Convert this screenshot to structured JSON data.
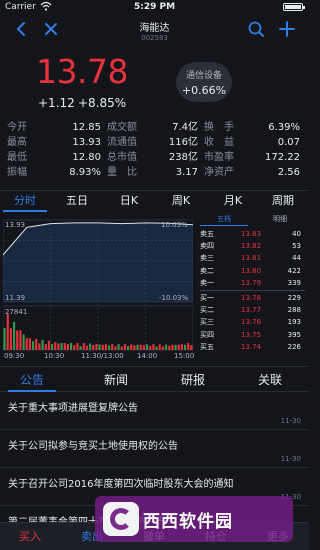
{
  "status_bar": {
    "carrier": "Carrier",
    "time": "5:29 PM"
  },
  "nav": {
    "title": "海能达",
    "code": "002583"
  },
  "quote": {
    "price": "13.78",
    "change_abs": "+1.12",
    "change_pct": "+8.85%"
  },
  "sector": {
    "name": "通信设备",
    "pct": "+0.66%"
  },
  "stats": [
    [
      {
        "label": "今开",
        "value": "12.85"
      },
      {
        "label": "成交额",
        "value": "7.4亿"
      },
      {
        "label": "换　手",
        "value": "6.39%"
      }
    ],
    [
      {
        "label": "最高",
        "value": "13.93"
      },
      {
        "label": "流通值",
        "value": "116亿"
      },
      {
        "label": "收　益",
        "value": "0.07"
      }
    ],
    [
      {
        "label": "最低",
        "value": "12.80"
      },
      {
        "label": "总市值",
        "value": "238亿"
      },
      {
        "label": "市盈率",
        "value": "172.22"
      }
    ],
    [
      {
        "label": "振幅",
        "value": "8.93%"
      },
      {
        "label": "量　比",
        "value": "3.17"
      },
      {
        "label": "净资产",
        "value": "2.56"
      }
    ]
  ],
  "chart_tabs": [
    "分时",
    "五日",
    "日K",
    "周K",
    "月K",
    "周期"
  ],
  "intraday": {
    "price_high": "13.93",
    "price_low": "11.39",
    "pct_high": "10.03%",
    "pct_low": "-10.03%",
    "volume_max": "27841",
    "time_labels": [
      "09:30",
      "10:30",
      "11:30/13:00",
      "14:00",
      "15:00"
    ]
  },
  "chart_data": {
    "type": "line",
    "title": "",
    "xlabel": "",
    "ylabel": "",
    "ylim": [
      11.39,
      13.93
    ],
    "x": [
      "09:30",
      "10:00",
      "10:30",
      "11:00",
      "11:30/13:00",
      "13:30",
      "14:00",
      "14:30",
      "15:00"
    ],
    "series": [
      {
        "values": [
          12.85,
          13.7,
          13.82,
          13.84,
          13.84,
          13.82,
          13.84,
          13.83,
          13.78
        ]
      }
    ],
    "volume": [
      27841,
      9000,
      6000,
      5000,
      4500,
      4000,
      4200,
      3800,
      5200
    ]
  },
  "order_book": {
    "tabs": [
      "五档",
      "明细"
    ],
    "asks": [
      {
        "level": "卖五",
        "price": "13.83",
        "volume": "40"
      },
      {
        "level": "卖四",
        "price": "13.82",
        "volume": "53"
      },
      {
        "level": "卖三",
        "price": "13.81",
        "volume": "44"
      },
      {
        "level": "卖二",
        "price": "13.80",
        "volume": "422"
      },
      {
        "level": "卖一",
        "price": "13.79",
        "volume": "339"
      }
    ],
    "bids": [
      {
        "level": "买一",
        "price": "13.78",
        "volume": "229"
      },
      {
        "level": "买二",
        "price": "13.77",
        "volume": "288"
      },
      {
        "level": "买三",
        "price": "13.76",
        "volume": "193"
      },
      {
        "level": "买四",
        "price": "13.75",
        "volume": "395"
      },
      {
        "level": "买五",
        "price": "13.74",
        "volume": "226"
      }
    ]
  },
  "info_tabs": [
    "公告",
    "新闻",
    "研报",
    "关联"
  ],
  "news": [
    {
      "headline": "关于重大事项进展暨复牌公告",
      "date": "11-30"
    },
    {
      "headline": "关于公司拟参与竞买土地使用权的公告",
      "date": "11-30"
    },
    {
      "headline": "关于召开公司2016年度第四次临时股东大会的通知",
      "date": "11-30"
    },
    {
      "headline": "第二届董事会第四十次会议决议公告",
      "date": "11-30"
    }
  ],
  "bottom_bar": {
    "buy": "买入",
    "sell": "卖出",
    "cancel": "撤单",
    "hold": "持仓",
    "more": "更多"
  },
  "watermark": {
    "text": "西西软件园"
  },
  "colors": {
    "up": "#e8323c",
    "accent": "#2f7de1",
    "background": "#13151b"
  }
}
